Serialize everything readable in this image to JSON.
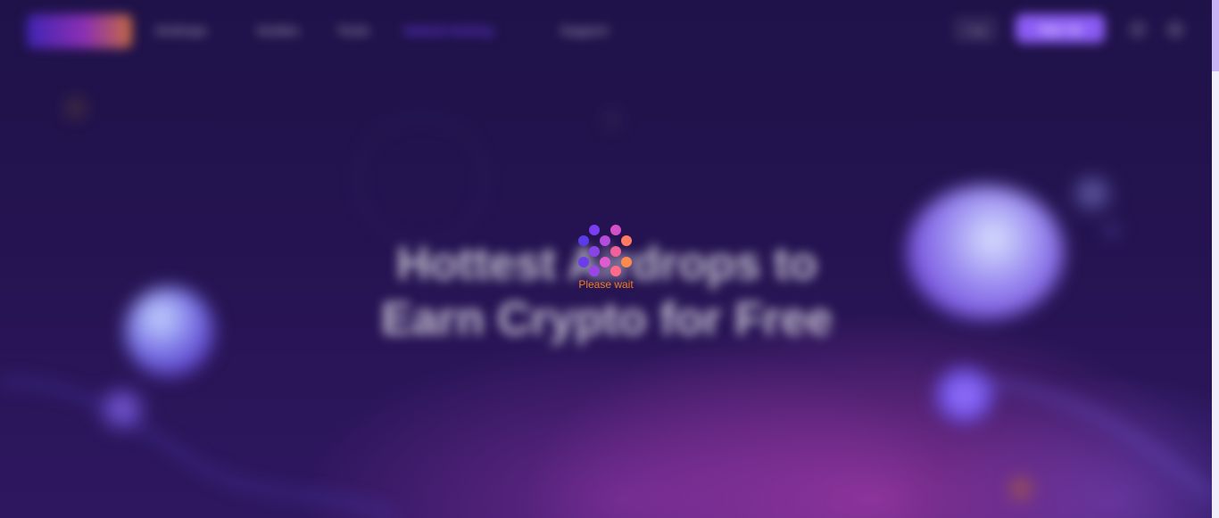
{
  "header": {
    "logo_name": "site-logo",
    "nav": [
      {
        "label": "Airdrops"
      },
      {
        "label": "Guides"
      },
      {
        "label": "Tools"
      },
      {
        "label": "Submit Airdrop"
      },
      {
        "label": "Support"
      }
    ],
    "login_label": "Log",
    "register_label": "Sign Up",
    "icons": [
      "search-icon",
      "user-icon"
    ]
  },
  "hero": {
    "title_line1": "Hottest Airdrops to",
    "title_line2": "Earn Crypto for Free",
    "subtitle": ""
  },
  "loader": {
    "text": "Please  wait"
  },
  "colors": {
    "background": "#21124a",
    "accent": "#8c5cf5",
    "loader_text": "#f07d1e",
    "loader_gradient": [
      "#6a3df0",
      "#d04fd8",
      "#ff8a5a"
    ]
  }
}
